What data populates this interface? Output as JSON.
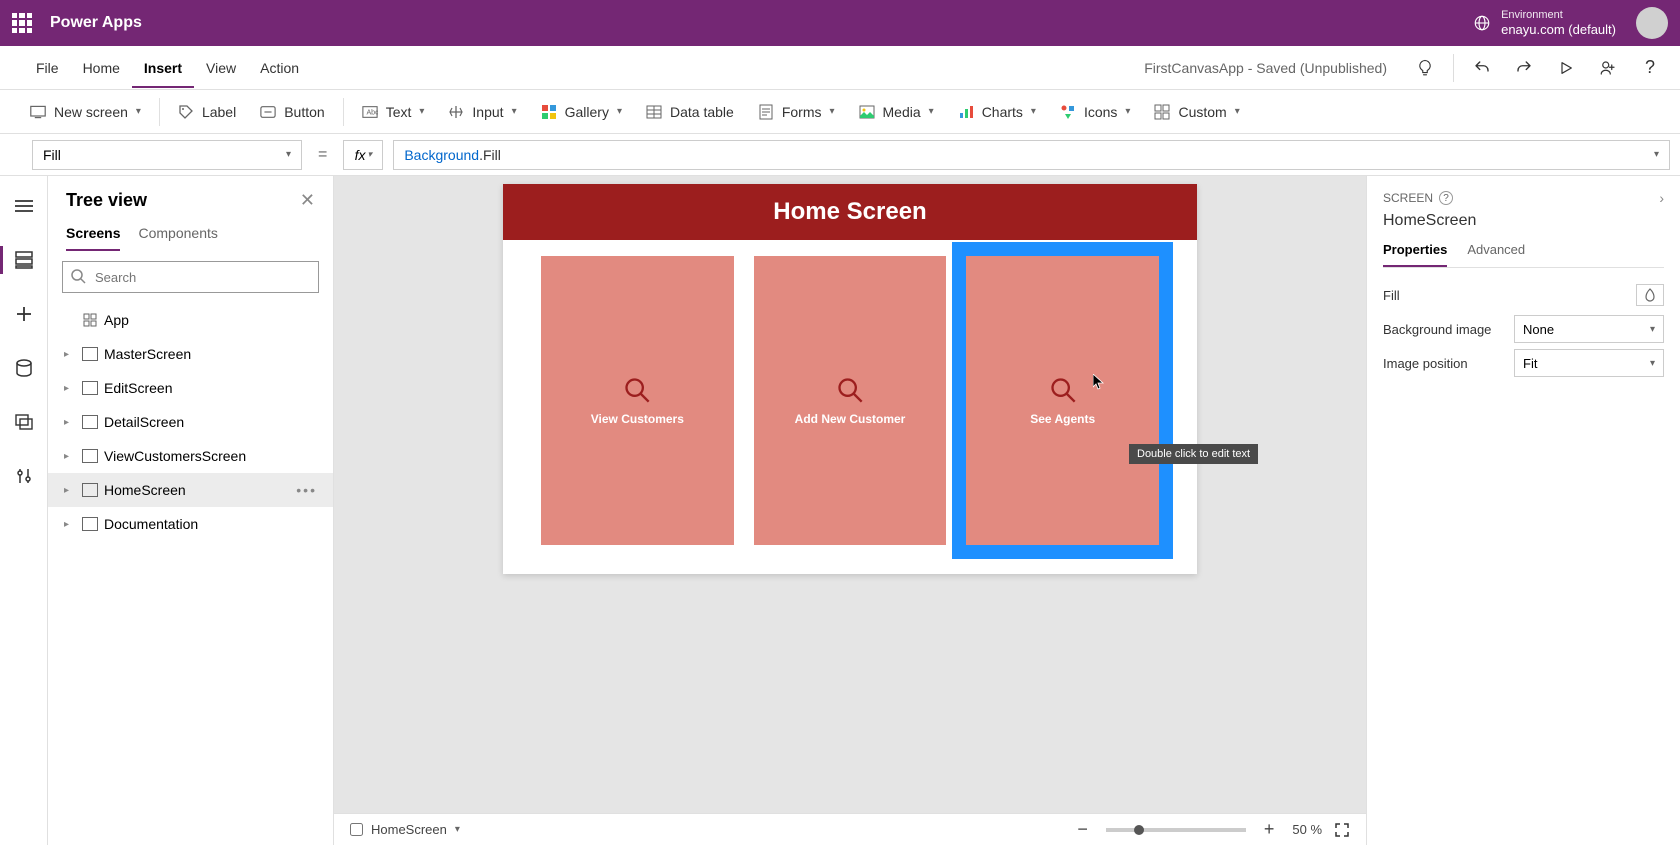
{
  "colors": {
    "brand": "#742774",
    "canvasHeader": "#9c1e1e",
    "card": "#e28a80",
    "selection": "#1e90ff"
  },
  "header": {
    "appName": "Power Apps",
    "envLabel": "Environment",
    "envName": "enayu.com (default)"
  },
  "menubar": {
    "items": [
      "File",
      "Home",
      "Insert",
      "View",
      "Action"
    ],
    "active": "Insert",
    "appTitle": "FirstCanvasApp - Saved (Unpublished)"
  },
  "ribbon": {
    "newScreen": "New screen",
    "label": "Label",
    "button": "Button",
    "text": "Text",
    "input": "Input",
    "gallery": "Gallery",
    "dataTable": "Data table",
    "forms": "Forms",
    "media": "Media",
    "charts": "Charts",
    "icons": "Icons",
    "custom": "Custom"
  },
  "formula": {
    "property": "Fill",
    "obj": "Background",
    "prop": ".Fill"
  },
  "tree": {
    "title": "Tree view",
    "tabs": {
      "screens": "Screens",
      "components": "Components"
    },
    "searchPlaceholder": "Search",
    "items": [
      {
        "label": "App",
        "hasChildren": false,
        "app": true
      },
      {
        "label": "MasterScreen",
        "hasChildren": true
      },
      {
        "label": "EditScreen",
        "hasChildren": true
      },
      {
        "label": "DetailScreen",
        "hasChildren": true
      },
      {
        "label": "ViewCustomersScreen",
        "hasChildren": true
      },
      {
        "label": "HomeScreen",
        "hasChildren": true,
        "selected": true
      },
      {
        "label": "Documentation",
        "hasChildren": true
      }
    ]
  },
  "canvas": {
    "headerText": "Home Screen",
    "cards": [
      {
        "label": "View Customers"
      },
      {
        "label": "Add New Customer"
      },
      {
        "label": "See Agents",
        "selected": true
      }
    ],
    "tooltip": "Double click to edit text"
  },
  "status": {
    "screenName": "HomeScreen",
    "zoom": "50",
    "zoomSuffix": " %"
  },
  "rightPanel": {
    "section": "SCREEN",
    "name": "HomeScreen",
    "tabs": {
      "properties": "Properties",
      "advanced": "Advanced"
    },
    "props": {
      "fillLabel": "Fill",
      "bgLabel": "Background image",
      "bgValue": "None",
      "imgPosLabel": "Image position",
      "imgPosValue": "Fit"
    }
  }
}
